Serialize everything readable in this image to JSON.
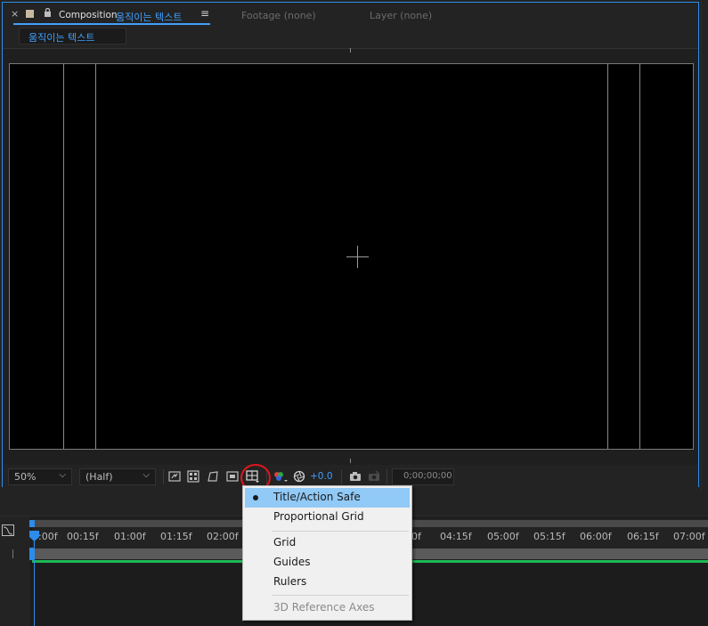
{
  "comp_panel": {
    "close_glyph": "×",
    "tab_label": "Composition",
    "tab_comp_name": "움직이는 텍스트",
    "menu_glyph": "≡",
    "footage_tab": "Footage  (none)",
    "layer_tab": "Layer  (none)",
    "breadcrumb": "움직이는 텍스트"
  },
  "toolbar": {
    "zoom": "50%",
    "resolution": "(Half)",
    "exposure": "+0.0",
    "timecode": "0;00;00;00",
    "icons": [
      "always-preview-icon",
      "transparency-grid-icon",
      "mask-path-icon",
      "region-of-interest-icon",
      "grid-guides-icon",
      "color-channels-icon",
      "reset-exposure-icon",
      "snapshot-icon",
      "show-snapshot-icon"
    ]
  },
  "timeline": {
    "ticks": [
      "0:00f",
      "00:15f",
      "01:00f",
      "01:15f",
      "02:00f",
      "0f",
      "04:15f",
      "05:00f",
      "05:15f",
      "06:00f",
      "06:15f",
      "07:00f"
    ]
  },
  "menu": {
    "items": [
      {
        "label": "Title/Action Safe",
        "selected": true
      },
      {
        "label": "Proportional Grid"
      },
      {
        "label": "Grid"
      },
      {
        "label": "Guides"
      },
      {
        "label": "Rulers"
      },
      {
        "label": "3D Reference Axes",
        "disabled": true
      }
    ]
  },
  "colors": {
    "accent": "#2d8ceb",
    "highlight": "#91c9f7",
    "annotation": "#e0161b",
    "green_bar": "#1db954"
  }
}
